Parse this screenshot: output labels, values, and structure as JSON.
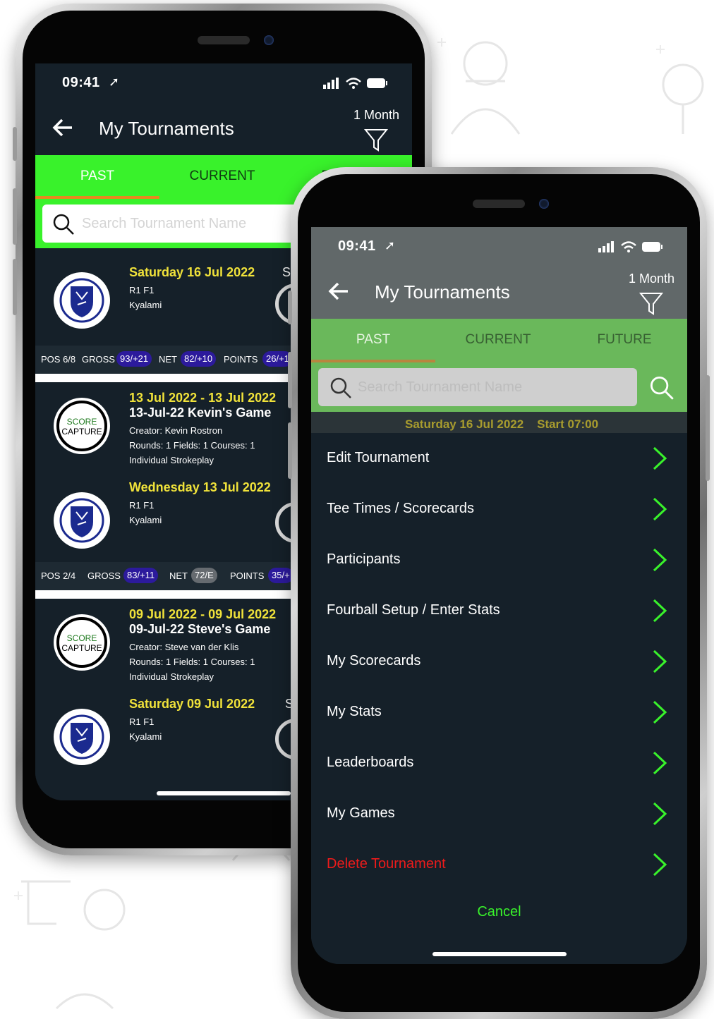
{
  "status": {
    "time": "09:41"
  },
  "header": {
    "title": "My Tournaments",
    "filter_label": "1 Month"
  },
  "tabs": [
    {
      "label": "PAST"
    },
    {
      "label": "CURRENT"
    },
    {
      "label": "FUTURE"
    }
  ],
  "search": {
    "placeholder": "Search Tournament Name"
  },
  "tournaments": [
    {
      "date": "Saturday 16 Jul 2022",
      "start": "S",
      "line1": "R1 F1",
      "line2": "Kyalami",
      "logo": "club-crest"
    },
    {
      "date": "13 Jul 2022 - 13 Jul 2022",
      "name": "13-Jul-22 Kevin's Game",
      "creator": "Creator: Kevin Rostron",
      "meta": "Rounds: 1 Fields: 1 Courses: 1",
      "format": "Individual Strokeplay",
      "logo": "score-capture"
    },
    {
      "date": "Wednesday 13 Jul 2022",
      "line1": "R1 F1",
      "line2": "Kyalami",
      "logo": "club-crest"
    },
    {
      "date": "09 Jul 2022 - 09 Jul 2022",
      "name": "09-Jul-22 Steve's Game",
      "creator": "Creator: Steve van der Klis",
      "meta": "Rounds: 1 Fields: 1 Courses: 1",
      "format": "Individual Strokeplay",
      "logo": "score-capture"
    },
    {
      "date": "Saturday 09 Jul 2022",
      "start": "S",
      "line1": "R1 F1",
      "line2": "Kyalami",
      "logo": "club-crest"
    }
  ],
  "scorebars": [
    {
      "pos": "POS 6/8",
      "gross_label": "GROSS",
      "gross": "93/+21",
      "net_label": "NET",
      "net": "82/+10",
      "points_label": "POINTS",
      "points": "26/+1"
    },
    {
      "pos": "POS 2/4",
      "gross_label": "GROSS",
      "gross": "83/+11",
      "net_label": "NET",
      "net": "72/E",
      "points_label": "POINTS",
      "points": "35/+"
    }
  ],
  "peek": {
    "text": "Saturday 16 Jul 2022    Start 07:00"
  },
  "menu": [
    {
      "label": "Edit Tournament"
    },
    {
      "label": "Tee Times / Scorecards"
    },
    {
      "label": "Participants"
    },
    {
      "label": "Fourball Setup / Enter Stats"
    },
    {
      "label": "My Scorecards"
    },
    {
      "label": "My Stats"
    },
    {
      "label": "Leaderboards"
    },
    {
      "label": "My Games"
    },
    {
      "label": "Delete Tournament",
      "danger": true
    }
  ],
  "cancel_label": "Cancel",
  "logo_text": {
    "line1": "SCORE",
    "line2": "CAPTURE"
  },
  "colors": {
    "accent_green": "#39f22b",
    "title_yellow": "#f0e23a",
    "danger_red": "#ee1b1b",
    "tab_indicator": "#e68a1f",
    "pill_blue": "#2c1a9c"
  }
}
